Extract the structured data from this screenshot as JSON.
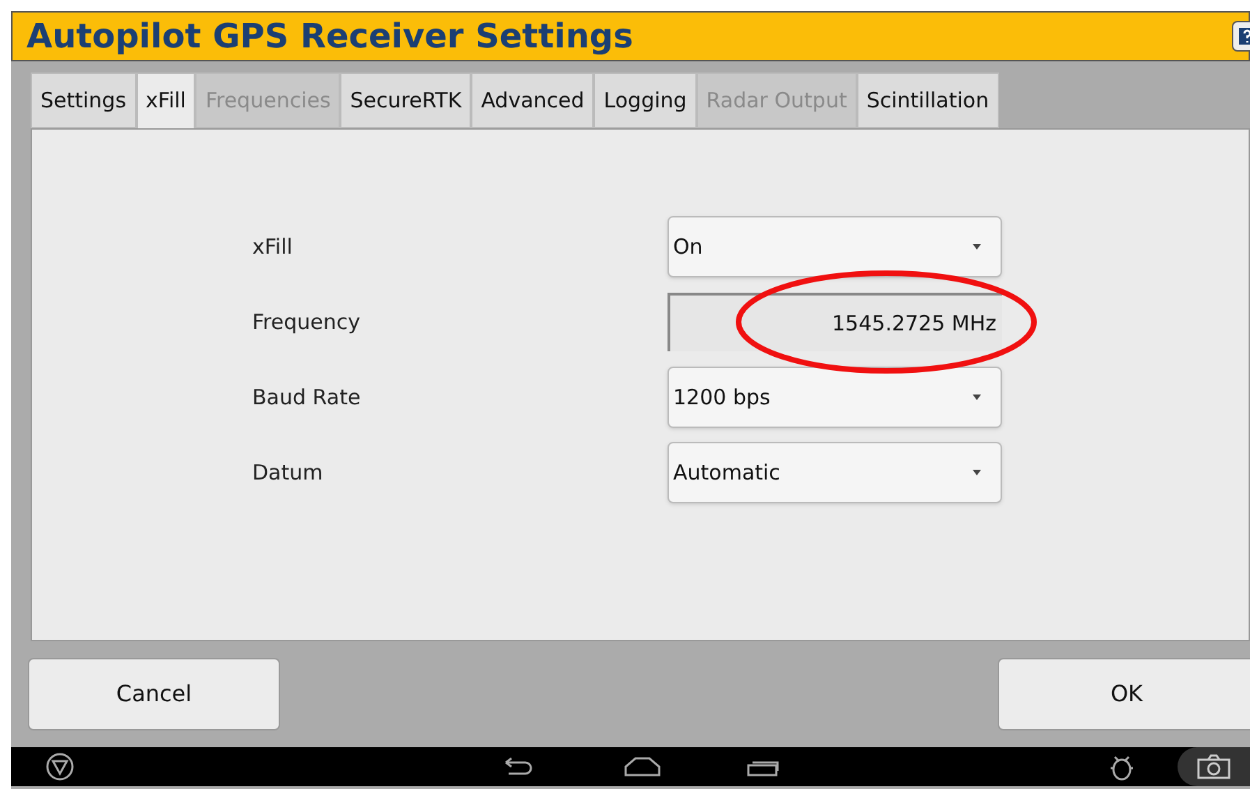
{
  "window": {
    "title": "Autopilot GPS Receiver Settings"
  },
  "tabs": [
    {
      "label": "Settings",
      "selected": false,
      "disabled": false
    },
    {
      "label": "xFill",
      "selected": true,
      "disabled": false
    },
    {
      "label": "Frequencies",
      "selected": false,
      "disabled": true
    },
    {
      "label": "SecureRTK",
      "selected": false,
      "disabled": false
    },
    {
      "label": "Advanced",
      "selected": false,
      "disabled": false
    },
    {
      "label": "Logging",
      "selected": false,
      "disabled": false
    },
    {
      "label": "Radar Output",
      "selected": false,
      "disabled": true
    },
    {
      "label": "Scintillation",
      "selected": false,
      "disabled": false
    }
  ],
  "fields": [
    {
      "label": "xFill",
      "kind": "dropdown",
      "value": "On"
    },
    {
      "label": "Frequency",
      "kind": "readout",
      "value": "1545.2725 MHz"
    },
    {
      "label": "Baud Rate",
      "kind": "dropdown",
      "value": "1200 bps"
    },
    {
      "label": "Datum",
      "kind": "dropdown",
      "value": "Automatic"
    }
  ],
  "buttons": [
    {
      "label": "Cancel"
    },
    {
      "label": "OK"
    }
  ]
}
